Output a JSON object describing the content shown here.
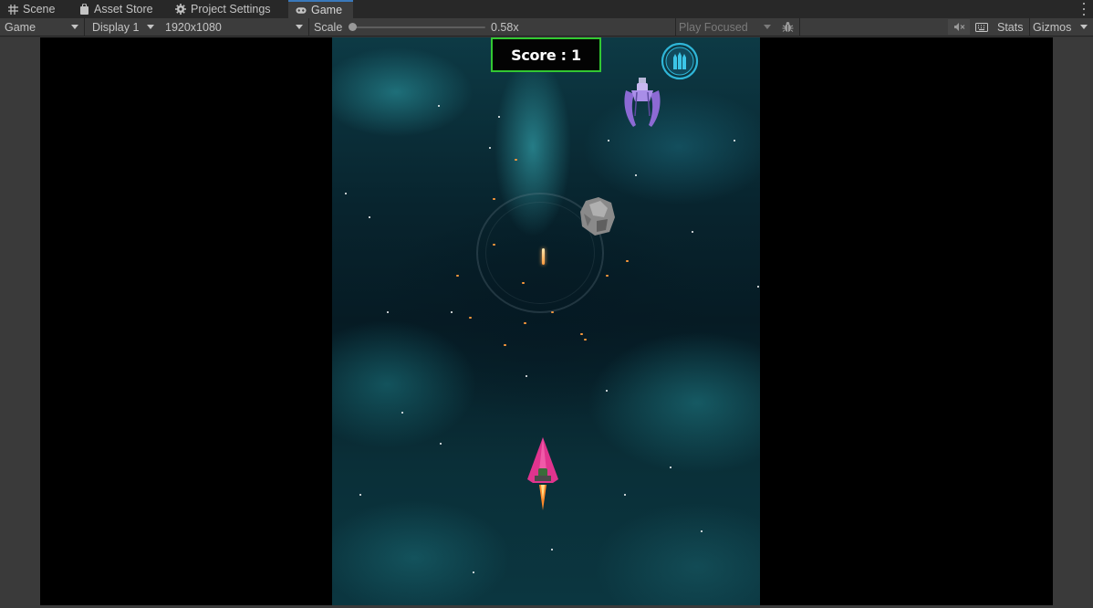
{
  "tabs": [
    {
      "label": "Scene",
      "icon": "grid-icon"
    },
    {
      "label": "Asset Store",
      "icon": "bag-icon"
    },
    {
      "label": "Project Settings",
      "icon": "gear-icon"
    },
    {
      "label": "Game",
      "icon": "gamepad-icon",
      "active": true
    }
  ],
  "toolbar": {
    "view_mode": "Game",
    "display": "Display 1",
    "resolution": "1920x1080",
    "scale_label": "Scale",
    "scale_value": "0.58x",
    "play_mode": "Play Focused",
    "stats_label": "Stats",
    "gizmos_label": "Gizmos"
  },
  "game": {
    "score_text": "Score : 1"
  },
  "colors": {
    "tab_accent": "#3a79bb",
    "score_border": "#32c832",
    "player_ship": "#e0348e"
  }
}
